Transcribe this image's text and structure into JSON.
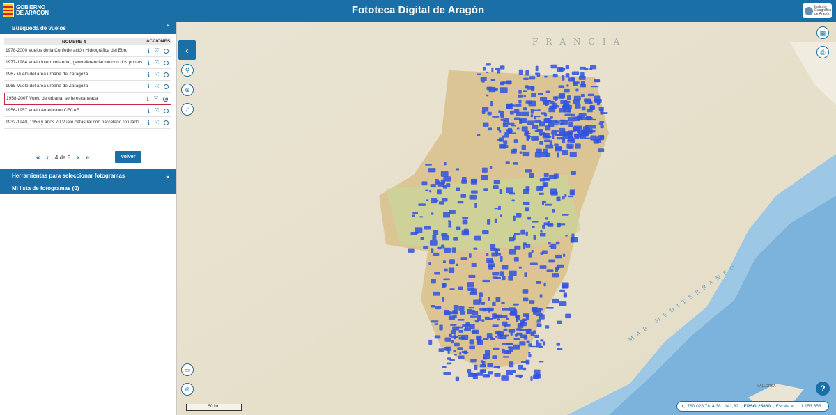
{
  "header": {
    "logo_line1": "GOBIERNO",
    "logo_line2": "DE ARAGON",
    "title": "Fototeca Digital de Aragón",
    "ign_logo_text": "Instituto Geográfico de Aragón"
  },
  "sidebar": {
    "search_panel_title": "Búsqueda de vuelos",
    "tools_panel_title": "Herramientas para seleccionar fotogramas",
    "list_panel_title": "Mi lista de fotogramas (0)",
    "table": {
      "col_name": "NOMBRE ⇕",
      "col_actions": "ACCIONES",
      "rows": [
        {
          "name": "1978-2000 Vuelos de la Confederación Hidrográfica del Ebro",
          "selected": false
        },
        {
          "name": "1977-1984 Vuelo interministerial, georreferenciación con dos puntos",
          "selected": false
        },
        {
          "name": "1967 Vuelo del área urbana de Zaragoza",
          "selected": false
        },
        {
          "name": "1965 Vuelo del área urbana de Zaragoza",
          "selected": false
        },
        {
          "name": "1958-2007 Vuelo de urbana, serie escaneada",
          "selected": true
        },
        {
          "name": "1956-1957 Vuelo Americano CECAF",
          "selected": false
        },
        {
          "name": "1932-1940, 1956 y años 70 Vuelo catastral con parcelario rotulado",
          "selected": false
        }
      ]
    },
    "pager": {
      "first": "«",
      "prev": "‹",
      "page_label": "4 de 5",
      "next": "›",
      "last": "»"
    },
    "back_button": "Volver"
  },
  "map": {
    "country_label": "FRANCIA",
    "sea_label": "MAR MEDITERRANEO",
    "city_label": "MALLORCA",
    "scale_text": "50 km",
    "coord_x": "760.028,78",
    "coord_y": "4.381.141,62",
    "epsg": "EPSG:25830",
    "scale_label": "Escala = 1 : 1.153.356",
    "help": "?"
  },
  "colors": {
    "primary": "#1a6fa6",
    "selected_row_border": "#c42a45",
    "coverage": "#2f52e0",
    "sea": "#9cc8e6"
  }
}
